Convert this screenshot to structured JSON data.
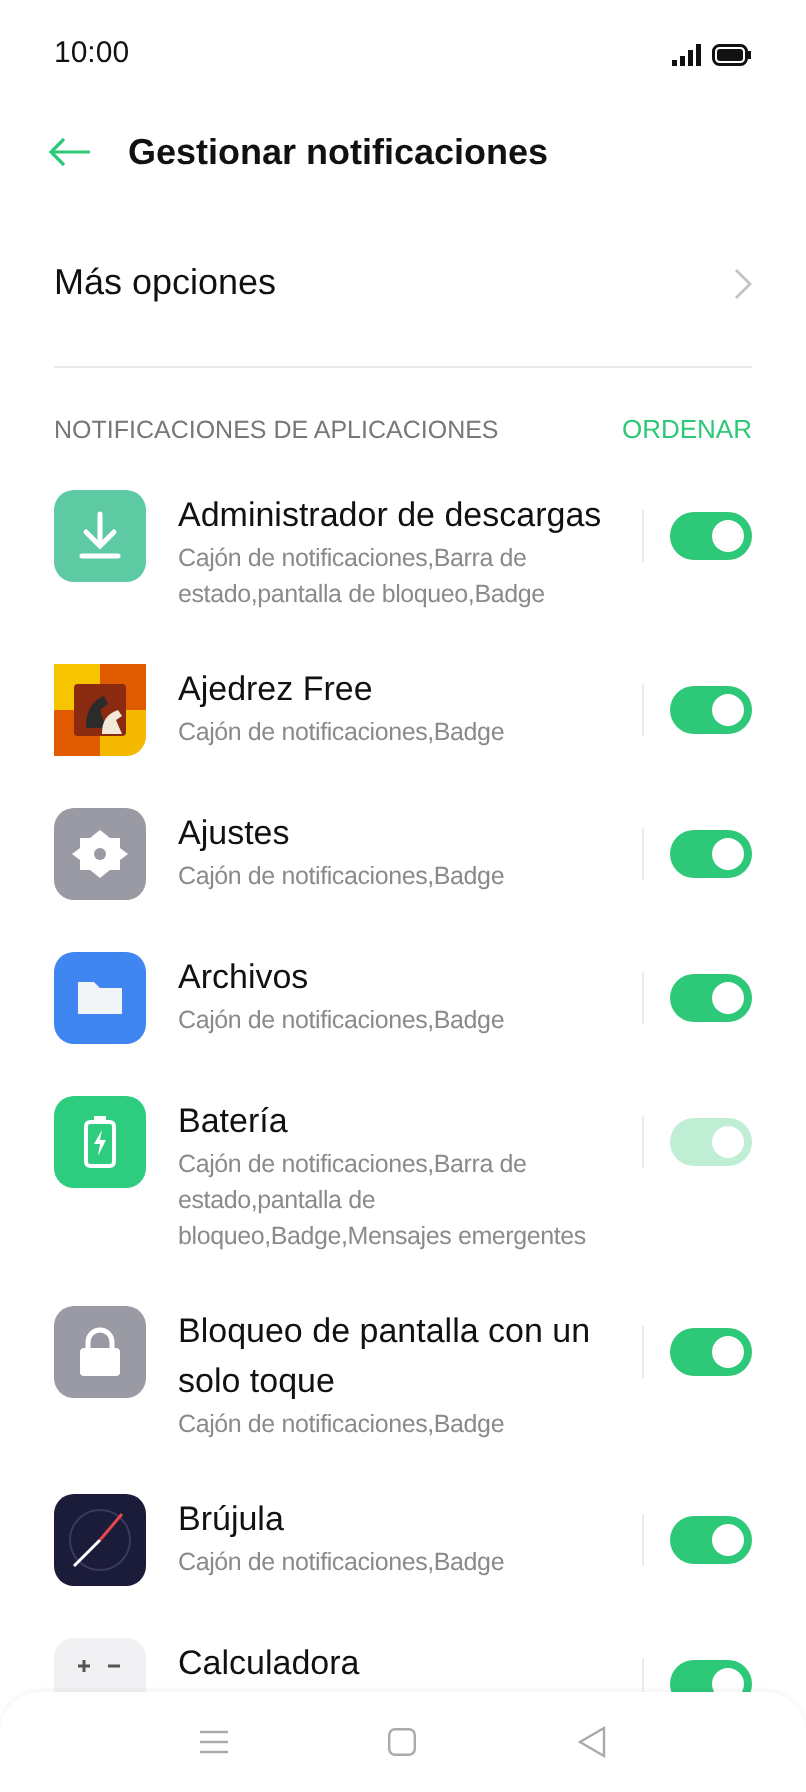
{
  "status_bar": {
    "time": "10:00"
  },
  "header": {
    "title": "Gestionar notificaciones"
  },
  "more_options": {
    "label": "Más opciones"
  },
  "section": {
    "title": "NOTIFICACIONES DE APLICACIONES",
    "action": "ORDENAR"
  },
  "apps": [
    {
      "name": "Administrador de descargas",
      "details": "Cajón de notificaciones,Barra de estado,pantalla de bloqueo,Badge",
      "on": true,
      "disabled": false
    },
    {
      "name": "Ajedrez Free",
      "details": "Cajón de notificaciones,Badge",
      "on": true,
      "disabled": false
    },
    {
      "name": "Ajustes",
      "details": "Cajón de notificaciones,Badge",
      "on": true,
      "disabled": false
    },
    {
      "name": "Archivos",
      "details": "Cajón de notificaciones,Badge",
      "on": true,
      "disabled": false
    },
    {
      "name": "Batería",
      "details": "Cajón de notificaciones,Barra de estado,pantalla de bloqueo,Badge,Mensajes emergentes",
      "on": true,
      "disabled": true
    },
    {
      "name": "Bloqueo de pantalla con un solo toque",
      "details": "Cajón de notificaciones,Badge",
      "on": true,
      "disabled": false
    },
    {
      "name": "Brújula",
      "details": "Cajón de notificaciones,Badge",
      "on": true,
      "disabled": false
    },
    {
      "name": "Calculadora",
      "on": true,
      "disabled": false
    }
  ]
}
